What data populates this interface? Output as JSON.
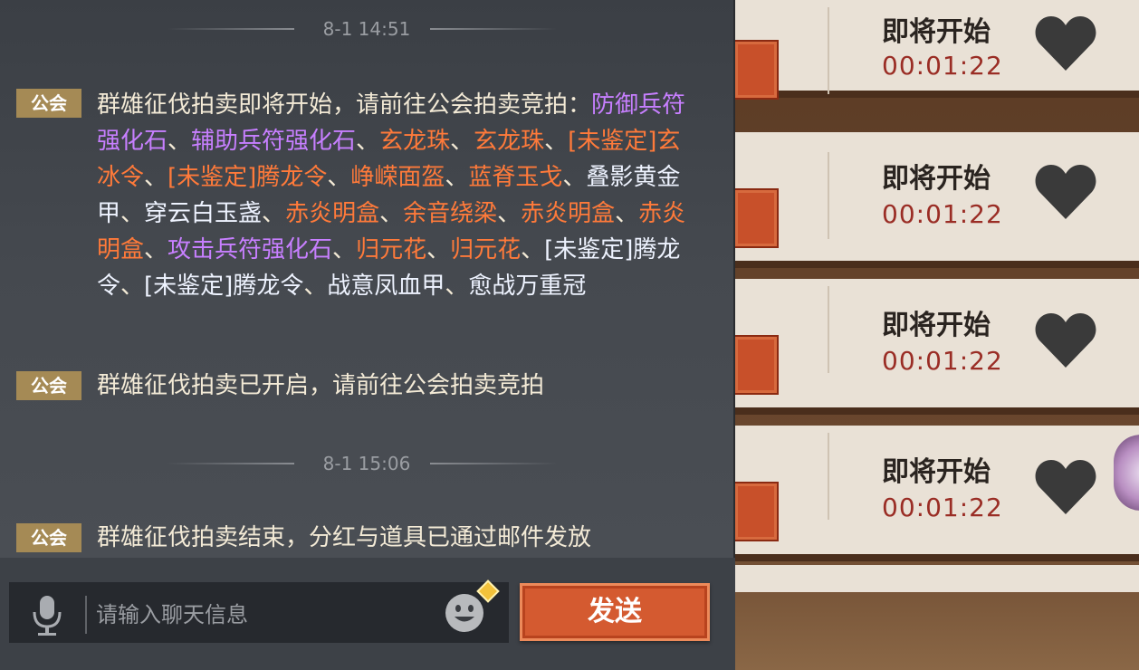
{
  "auction_list": {
    "items": [
      {
        "status": "即将开始",
        "timer": "00:01:22"
      },
      {
        "status": "即将开始",
        "timer": "00:01:22"
      },
      {
        "status": "即将开始",
        "timer": "00:01:22"
      },
      {
        "status": "即将开始",
        "timer": "00:01:22"
      }
    ]
  },
  "chat": {
    "separators": [
      {
        "time": "8-1 14:51"
      },
      {
        "time": "8-1 15:06"
      }
    ],
    "messages": [
      {
        "tag": "公会",
        "segments": [
          {
            "text": "群雄征伐拍卖即将开始，请前往公会拍卖竞拍：",
            "color": "#f3ead6"
          },
          {
            "text": "防御兵符强化石",
            "color": "#c77fff"
          },
          {
            "text": "、",
            "color": "#f3ead6"
          },
          {
            "text": "辅助兵符强化石",
            "color": "#c77fff"
          },
          {
            "text": "、",
            "color": "#f3ead6"
          },
          {
            "text": "玄龙珠",
            "color": "#ff7a3a"
          },
          {
            "text": "、",
            "color": "#f3ead6"
          },
          {
            "text": "玄龙珠",
            "color": "#ff7a3a"
          },
          {
            "text": "、",
            "color": "#f3ead6"
          },
          {
            "text": "[未鉴定]玄冰令",
            "color": "#ff7a3a"
          },
          {
            "text": "、",
            "color": "#f3ead6"
          },
          {
            "text": "[未鉴定]腾龙令",
            "color": "#ff7a3a"
          },
          {
            "text": "、",
            "color": "#f3ead6"
          },
          {
            "text": "峥嵘面盔",
            "color": "#ff7a3a"
          },
          {
            "text": "、",
            "color": "#f3ead6"
          },
          {
            "text": "蓝脊玉戈",
            "color": "#ff7a3a"
          },
          {
            "text": "、",
            "color": "#f3ead6"
          },
          {
            "text": "叠影黄金甲",
            "color": "#eef3ff"
          },
          {
            "text": "、",
            "color": "#f3ead6"
          },
          {
            "text": "穿云白玉盏",
            "color": "#eef3ff"
          },
          {
            "text": "、",
            "color": "#f3ead6"
          },
          {
            "text": "赤炎明盒",
            "color": "#ff7a3a"
          },
          {
            "text": "、",
            "color": "#f3ead6"
          },
          {
            "text": "余音绕梁",
            "color": "#ff7a3a"
          },
          {
            "text": "、",
            "color": "#f3ead6"
          },
          {
            "text": "赤炎明盒",
            "color": "#ff7a3a"
          },
          {
            "text": "、",
            "color": "#f3ead6"
          },
          {
            "text": "赤炎明盒",
            "color": "#ff7a3a"
          },
          {
            "text": "、",
            "color": "#f3ead6"
          },
          {
            "text": "攻击兵符强化石",
            "color": "#c77fff"
          },
          {
            "text": "、",
            "color": "#f3ead6"
          },
          {
            "text": "归元花",
            "color": "#ff7a3a"
          },
          {
            "text": "、",
            "color": "#f3ead6"
          },
          {
            "text": "归元花",
            "color": "#ff7a3a"
          },
          {
            "text": "、",
            "color": "#f3ead6"
          },
          {
            "text": "[未鉴定]腾龙令",
            "color": "#eef3ff"
          },
          {
            "text": "、",
            "color": "#f3ead6"
          },
          {
            "text": "[未鉴定]腾龙令",
            "color": "#eef3ff"
          },
          {
            "text": "、",
            "color": "#f3ead6"
          },
          {
            "text": "战意凤血甲",
            "color": "#eef3ff"
          },
          {
            "text": "、",
            "color": "#f3ead6"
          },
          {
            "text": "愈战万重冠",
            "color": "#eef3ff"
          }
        ]
      },
      {
        "tag": "公会",
        "text": "群雄征伐拍卖已开启，请前往公会拍卖竞拍"
      },
      {
        "tag": "公会",
        "text": "群雄征伐拍卖结束，分红与道具已通过邮件发放"
      }
    ]
  },
  "input": {
    "placeholder": "请输入聊天信息",
    "send_label": "发送"
  },
  "icons": {
    "mic": "microphone-icon",
    "emoji": "emoji-icon",
    "heart": "heart-icon"
  }
}
